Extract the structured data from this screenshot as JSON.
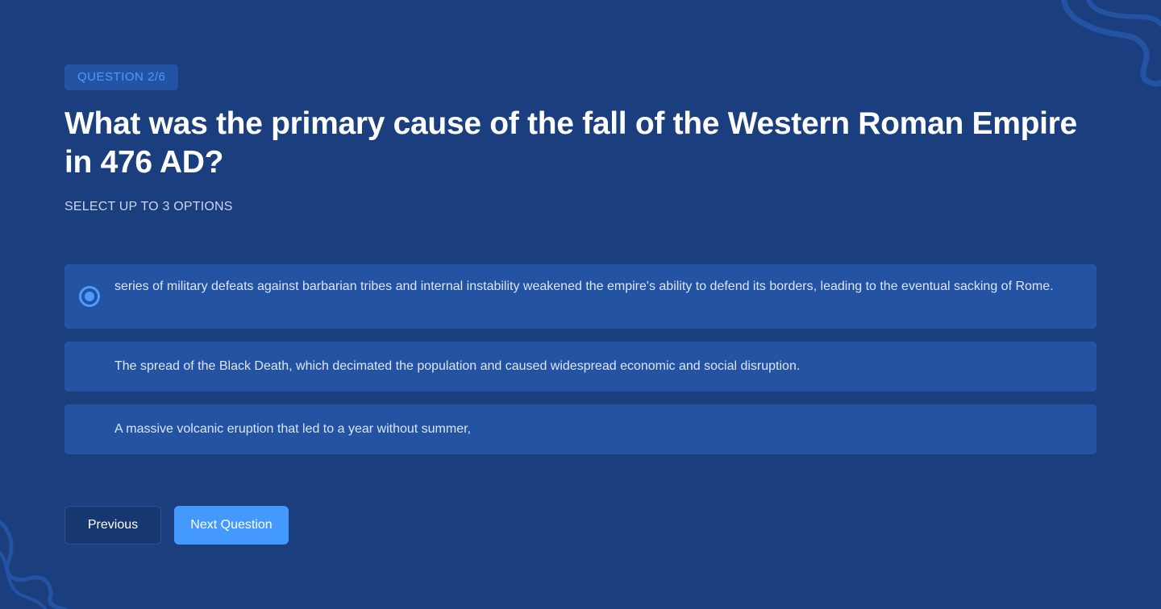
{
  "question": {
    "badge": "QUESTION 2/6",
    "title": "What was the primary cause of the fall of the Western Roman Empire in 476 AD?",
    "instruction": "SELECT UP TO 3 OPTIONS"
  },
  "options": [
    {
      "text": "series of military defeats against barbarian tribes and internal instability weakened the empire's ability to defend its borders, leading to the eventual sacking of Rome.",
      "selected": true
    },
    {
      "text": "The spread of the Black Death, which decimated the population and caused widespread economic and social disruption.",
      "selected": false
    },
    {
      "text": "A massive volcanic eruption that led to a year without summer,",
      "selected": false
    }
  ],
  "navigation": {
    "previous_label": "Previous",
    "next_label": "Next Question"
  },
  "colors": {
    "background": "#1b3f7e",
    "option_background": "#2453a4",
    "accent": "#4499ff",
    "decoration": "#2453a4"
  },
  "icons": {
    "selected_radio": "radio-checked-icon",
    "decoration": "wave-decoration"
  }
}
